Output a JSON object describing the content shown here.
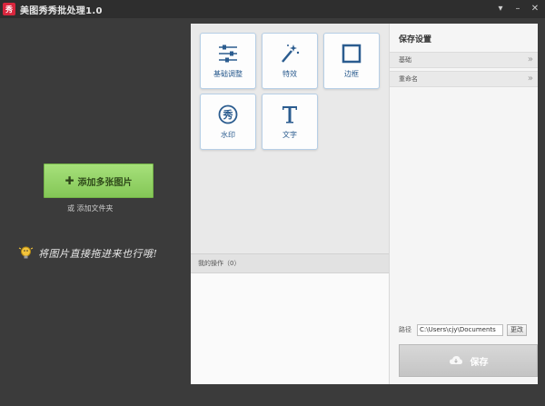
{
  "window": {
    "logo_text": "秀",
    "title": "美图秀秀批处理1.0",
    "controls": [
      "▾",
      "–",
      "✕"
    ]
  },
  "left": {
    "add_photos_label": "添加多张图片",
    "add_folder_label": "或 添加文件夹",
    "drag_hint": "将图片直接拖进来也行哦!"
  },
  "tools": [
    {
      "label": "基础调整",
      "icon": "sliders-icon"
    },
    {
      "label": "特效",
      "icon": "magic-wand-icon"
    },
    {
      "label": "边框",
      "icon": "frame-icon"
    },
    {
      "label": "水印",
      "icon": "watermark-icon"
    },
    {
      "label": "文字",
      "icon": "text-icon"
    }
  ],
  "operations": {
    "label": "我的操作（0）"
  },
  "settings": {
    "title": "保存设置",
    "rows": [
      "基础",
      "重命名"
    ],
    "path_label": "路径",
    "path_value": "C:\\Users\\cjy\\Documents",
    "change_label": "更改",
    "save_label": "保存"
  },
  "colors": {
    "accent_green": "#84c757",
    "tool_blue": "#2b5c8f",
    "dark_bg": "#3b3b3b"
  }
}
